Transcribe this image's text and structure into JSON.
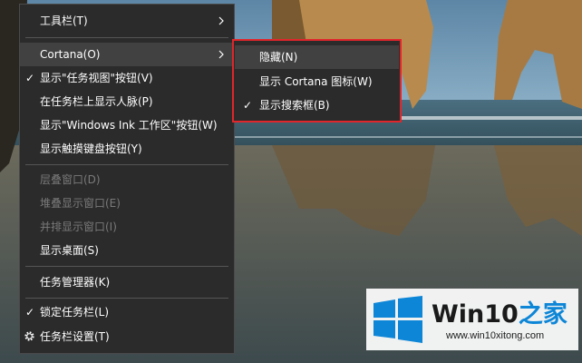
{
  "menu": {
    "items": [
      {
        "label": "工具栏(T)",
        "checked": false,
        "disabled": false,
        "submenu": true
      },
      {
        "label": "Cortana(O)",
        "checked": false,
        "disabled": false,
        "submenu": true,
        "highlighted": true
      },
      {
        "label": "显示\"任务视图\"按钮(V)",
        "checked": true,
        "disabled": false
      },
      {
        "label": "在任务栏上显示人脉(P)",
        "checked": false,
        "disabled": false
      },
      {
        "label": "显示\"Windows Ink 工作区\"按钮(W)",
        "checked": false,
        "disabled": false
      },
      {
        "label": "显示触摸键盘按钮(Y)",
        "checked": false,
        "disabled": false
      },
      {
        "label": "层叠窗口(D)",
        "checked": false,
        "disabled": true
      },
      {
        "label": "堆叠显示窗口(E)",
        "checked": false,
        "disabled": true
      },
      {
        "label": "并排显示窗口(I)",
        "checked": false,
        "disabled": true
      },
      {
        "label": "显示桌面(S)",
        "checked": false,
        "disabled": false
      },
      {
        "label": "任务管理器(K)",
        "checked": false,
        "disabled": false
      },
      {
        "label": "锁定任务栏(L)",
        "checked": true,
        "disabled": false
      },
      {
        "label": "任务栏设置(T)",
        "checked": false,
        "disabled": false,
        "icon": "gear-icon"
      }
    ],
    "check_glyph": "✓"
  },
  "submenu": {
    "items": [
      {
        "label": "隐藏(N)",
        "checked": false,
        "highlighted": true
      },
      {
        "label": "显示 Cortana 图标(W)",
        "checked": false
      },
      {
        "label": "显示搜索框(B)",
        "checked": true
      }
    ],
    "highlight_color": "#e0252b"
  },
  "watermark": {
    "title_main": "Win10",
    "title_accent": "之家",
    "url": "www.win10xitong.com",
    "accent_color": "#0d86d7"
  }
}
